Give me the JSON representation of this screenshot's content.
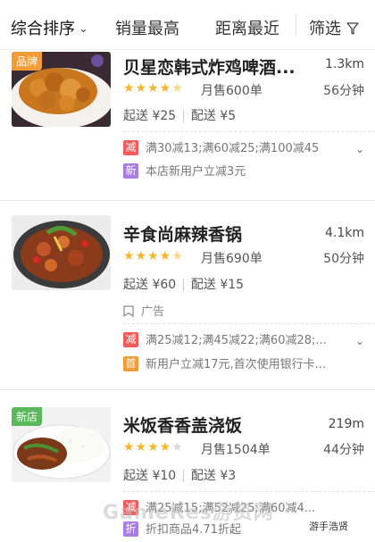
{
  "sort_bar": {
    "items": [
      {
        "label": "综合排序",
        "active": true,
        "has_chevron": true
      },
      {
        "label": "销量最高",
        "active": false
      },
      {
        "label": "距离最近",
        "active": false
      }
    ],
    "filter_label": "筛选"
  },
  "shops": [
    {
      "badge": "品牌",
      "name": "贝星恋韩式炸鸡啤酒...",
      "distance": "1.3km",
      "rating_stars": 4.5,
      "monthly_sales": "月售600单",
      "delivery_time": "56分钟",
      "min_order": "起送 ¥25",
      "delivery_fee": "配送 ¥5",
      "promotions": [
        {
          "tag": "减",
          "tag_color": "#f25c5c",
          "text": "满30减13;满60减25;满100减45"
        },
        {
          "tag": "新",
          "tag_color": "#a77de3",
          "text": "本店新用户立减3元"
        }
      ]
    },
    {
      "badge": "",
      "name": "辛食尚麻辣香锅",
      "distance": "4.1km",
      "rating_stars": 4.5,
      "monthly_sales": "月售690单",
      "delivery_time": "50分钟",
      "min_order": "起送 ¥60",
      "delivery_fee": "配送 ¥15",
      "ad_label": "广告",
      "promotions": [
        {
          "tag": "减",
          "tag_color": "#f25c5c",
          "text": "满25减12;满45减22;满60减28;..."
        },
        {
          "tag": "首",
          "tag_color": "#f29c38",
          "text": "新用户立减17元,首次使用银行卡..."
        }
      ]
    },
    {
      "badge": "新店",
      "name": "米饭香香盖浇饭",
      "distance": "219m",
      "rating_stars": 4,
      "monthly_sales": "月售1504单",
      "delivery_time": "44分钟",
      "min_order": "起送 ¥10",
      "delivery_fee": "配送 ¥3",
      "promotions": [
        {
          "tag": "减",
          "tag_color": "#f25c5c",
          "text": "满25减15;满52减25;满60减4..."
        },
        {
          "tag": "折",
          "tag_color": "#a77de3",
          "text": "折扣商品4.71折起"
        }
      ]
    }
  ],
  "watermark": "GameRes游资网",
  "wechat_mark": "游手浩贤"
}
